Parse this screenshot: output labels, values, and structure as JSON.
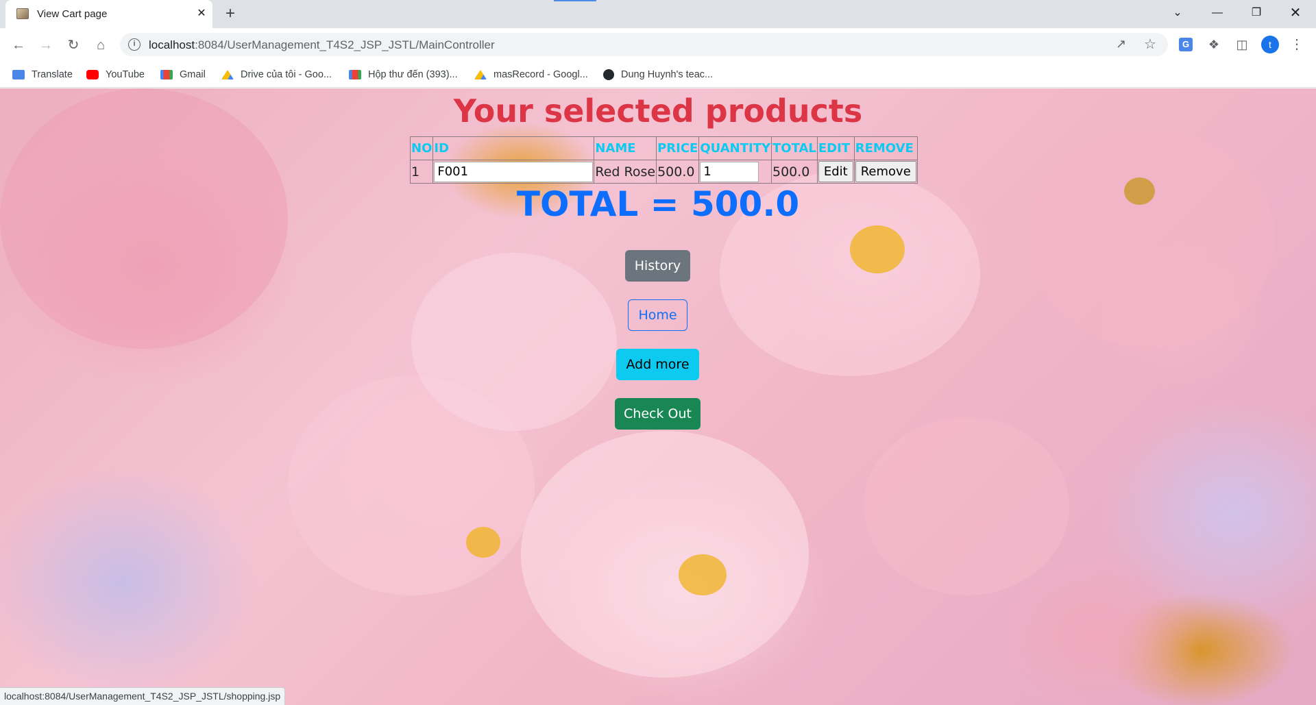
{
  "browser": {
    "tab_title": "View Cart page",
    "tab_close_glyph": "✕",
    "new_tab_glyph": "+",
    "url_host": "localhost",
    "url_rest": ":8084/UserManagement_T4S2_JSP_JSTL/MainController",
    "profile_initial": "t",
    "status_url": "localhost:8084/UserManagement_T4S2_JSP_JSTL/shopping.jsp",
    "bookmarks": [
      {
        "label": "Translate",
        "icon": "google-translate-icon",
        "color": "#4a86e8"
      },
      {
        "label": "YouTube",
        "icon": "youtube-icon",
        "color": "#ff0000"
      },
      {
        "label": "Gmail",
        "icon": "gmail-icon",
        "color": "#ea4335"
      },
      {
        "label": "Drive của tôi - Goo...",
        "icon": "google-drive-icon",
        "color": "#34a853"
      },
      {
        "label": "Hộp thư đến (393)...",
        "icon": "gmail-icon",
        "color": "#ea4335"
      },
      {
        "label": "masRecord - Googl...",
        "icon": "google-drive-icon",
        "color": "#fbbc04"
      },
      {
        "label": "Dung Huynh's teac...",
        "icon": "github-icon",
        "color": "#24292e"
      }
    ]
  },
  "page": {
    "heading": "Your selected products",
    "table": {
      "headers": [
        "NO",
        "ID",
        "NAME",
        "PRICE",
        "QUANTITY",
        "TOTAL",
        "EDIT",
        "REMOVE"
      ],
      "rows": [
        {
          "no": "1",
          "id": "F001",
          "name": "Red Rose",
          "price": "500.0",
          "quantity": "1",
          "total": "500.0",
          "edit_label": "Edit",
          "remove_label": "Remove"
        }
      ]
    },
    "total_text": "TOTAL = 500.0",
    "buttons": {
      "history": "History",
      "home": "Home",
      "add_more": "Add more",
      "check_out": "Check Out"
    }
  },
  "colors": {
    "heading": "#dc3545",
    "header_text": "#0dcaf0",
    "total": "#0d6efd",
    "history_btn": "#6c757d",
    "home_btn_outline": "#0d6efd",
    "add_more_btn": "#0dcaf0",
    "check_out_btn": "#198754"
  }
}
